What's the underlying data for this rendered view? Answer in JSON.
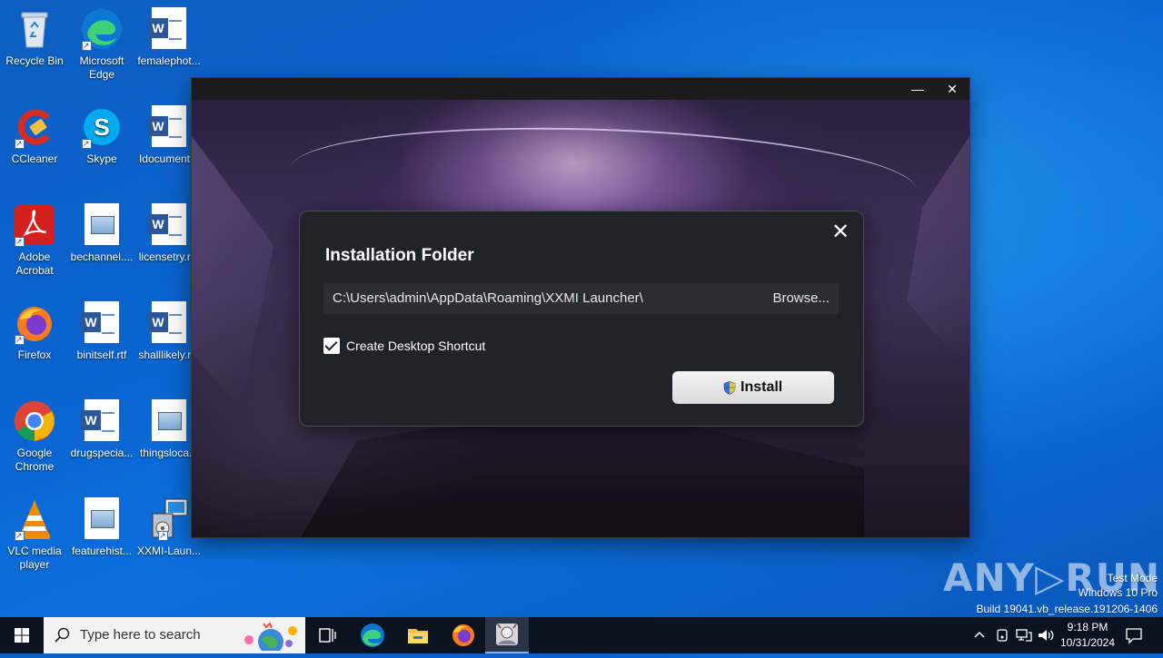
{
  "desktop": {
    "icons": [
      {
        "label": "Recycle Bin",
        "icon": "recycle-bin-icon"
      },
      {
        "label": "Microsoft Edge",
        "icon": "edge-icon"
      },
      {
        "label": "femalephot...",
        "icon": "word-doc-icon"
      },
      {
        "label": "CCleaner",
        "icon": "ccleaner-icon"
      },
      {
        "label": "Skype",
        "icon": "skype-icon"
      },
      {
        "label": "Idocument...",
        "icon": "word-doc-icon"
      },
      {
        "label": "Adobe Acrobat",
        "icon": "acrobat-icon"
      },
      {
        "label": "bechannel....",
        "icon": "image-file-icon"
      },
      {
        "label": "licensetry.r...",
        "icon": "word-doc-icon"
      },
      {
        "label": "Firefox",
        "icon": "firefox-icon"
      },
      {
        "label": "binitself.rtf",
        "icon": "word-doc-icon"
      },
      {
        "label": "shalllikely.r...",
        "icon": "word-doc-icon"
      },
      {
        "label": "Google Chrome",
        "icon": "chrome-icon"
      },
      {
        "label": "drugspecia...",
        "icon": "word-doc-icon"
      },
      {
        "label": "thingsloca...",
        "icon": "image-file-icon"
      },
      {
        "label": "VLC media player",
        "icon": "vlc-icon"
      },
      {
        "label": "featurehist...",
        "icon": "image-file-icon"
      },
      {
        "label": "XXMI-Laun...",
        "icon": "installer-icon"
      }
    ]
  },
  "app_window": {
    "minimize_glyph": "—",
    "close_glyph": "✕"
  },
  "dialog": {
    "title": "Installation Folder",
    "close_glyph": "✕",
    "path_value": "C:\\Users\\admin\\AppData\\Roaming\\XXMI Launcher\\",
    "browse_label": "Browse...",
    "shortcut_label": "Create Desktop Shortcut",
    "shortcut_checked": true,
    "install_label": "Install"
  },
  "watermark": {
    "logo_text": "ANY▷RUN",
    "mode": "Test Mode",
    "edition": "Windows 10 Pro",
    "build": "Build 19041.vb_release.191206-1406"
  },
  "taskbar": {
    "search_placeholder": "Type here to search",
    "pinned": [
      "task-view-icon",
      "edge-icon",
      "file-explorer-icon",
      "firefox-icon",
      "xxmi-launcher-icon"
    ],
    "time": "9:18 PM",
    "date": "10/31/2024"
  },
  "colors": {
    "desktop_blue": "#0a63cf",
    "dialog_bg": "#222329",
    "taskbar_bg": "#0b1220"
  }
}
